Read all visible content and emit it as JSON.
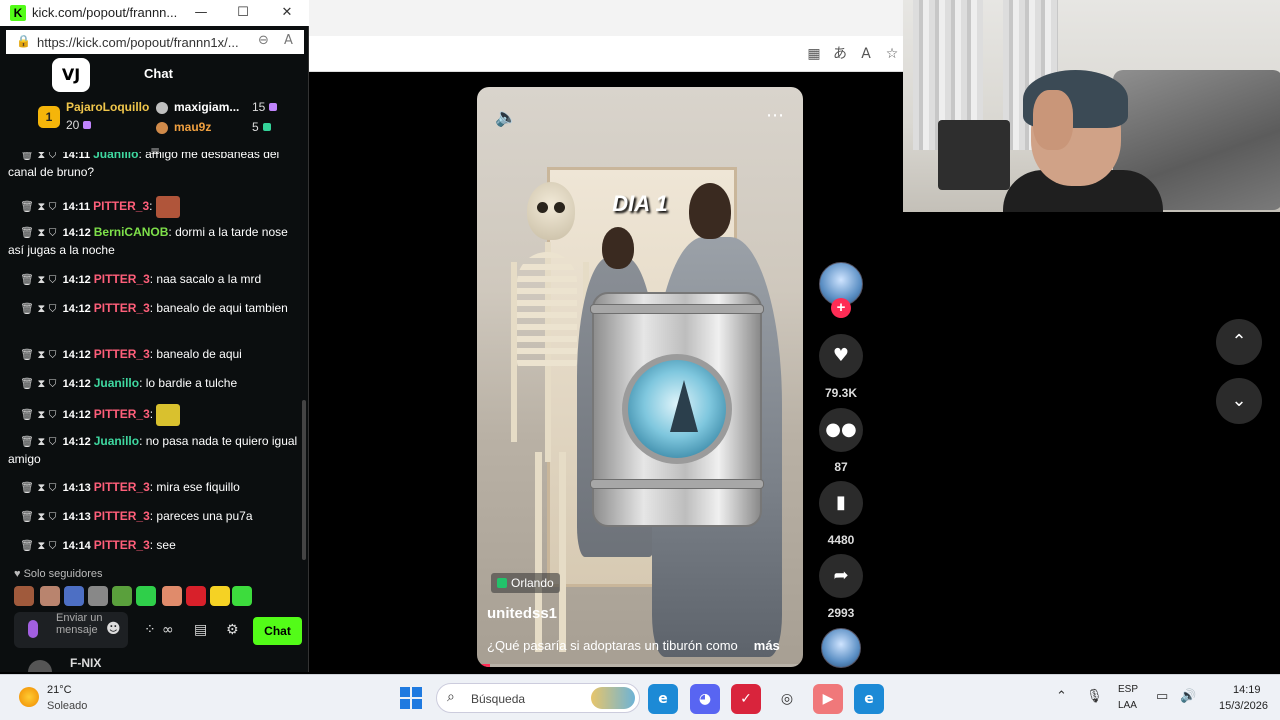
{
  "popout": {
    "window_title": "kick.com/popout/frannn...",
    "url": "https://kick.com/popout/frannn1x/...",
    "chat_title": "Chat",
    "logo_text": "VJ"
  },
  "leaderboard": {
    "first": {
      "rank": "1",
      "name": "PajaroLoquillo",
      "count": "20"
    },
    "others": [
      {
        "name": "maxigiam...",
        "count": "15",
        "color": "#ffffff",
        "medal": "#bfbfbf",
        "gem": "#c084fc"
      },
      {
        "name": "mau9z",
        "count": "5",
        "color": "#f0a040",
        "medal": "#d08a4a",
        "gem": "#34d399"
      }
    ]
  },
  "messages": [
    {
      "time": "14:11",
      "user": "Juanillo",
      "user_color": "#3fd8a0",
      "text": "amigo me desbaneas del canal de bruno?"
    },
    {
      "time": "14:11",
      "user": "PITTER_3",
      "user_color": "#ff5f7a",
      "text": "",
      "emote": "meme-emote"
    },
    {
      "time": "14:12",
      "user": "BerniCANOB",
      "user_color": "#7ee04a",
      "text": "dormi a la tarde nose así jugas a la noche"
    },
    {
      "time": "14:12",
      "user": "PITTER_3",
      "user_color": "#ff5f7a",
      "text": "naa sacalo a la mrd"
    },
    {
      "time": "14:12",
      "user": "PITTER_3",
      "user_color": "#ff5f7a",
      "text": "banealo de aqui tambien"
    },
    {
      "time": "14:12",
      "user": "PITTER_3",
      "user_color": "#ff5f7a",
      "text": "banealo de aqui"
    },
    {
      "time": "14:12",
      "user": "Juanillo",
      "user_color": "#3fd8a0",
      "text": "lo bardie a tulche"
    },
    {
      "time": "14:12",
      "user": "PITTER_3",
      "user_color": "#ff5f7a",
      "text": "",
      "emote": "face-emote"
    },
    {
      "time": "14:12",
      "user": "Juanillo",
      "user_color": "#3fd8a0",
      "text": "no pasa nada te quiero igual amigo"
    },
    {
      "time": "14:13",
      "user": "PITTER_3",
      "user_color": "#ff5f7a",
      "text": "mira ese fiquillo"
    },
    {
      "time": "14:13",
      "user": "PITTER_3",
      "user_color": "#ff5f7a",
      "text": "pareces una pu7a"
    },
    {
      "time": "14:14",
      "user": "PITTER_3",
      "user_color": "#ff5f7a",
      "text": "see"
    }
  ],
  "chat_footer": {
    "followers_only": "Solo seguidores",
    "input_placeholder": "Enviar un mensaje",
    "send_label": "Chat",
    "next_user": "F-NIX"
  },
  "video": {
    "overlay_text": "DIA 1",
    "location": "Orlando",
    "author": "unitedss1",
    "caption": "¿Qué pasaría si adoptaras un tiburón como",
    "more": "más",
    "progress": 0.04
  },
  "actions": {
    "likes": "79.3K",
    "comments": "87",
    "saves": "4480",
    "shares": "2993"
  },
  "taskbar": {
    "temperature": "21°C",
    "weather": "Soleado",
    "search_placeholder": "Búsqueda",
    "lang_line1": "ESP",
    "lang_line2": "LAA",
    "time": "14:19",
    "date": "15/3/2026"
  },
  "colors": {
    "kick_green": "#53fc18",
    "tiktok_red": "#fe2c55"
  }
}
